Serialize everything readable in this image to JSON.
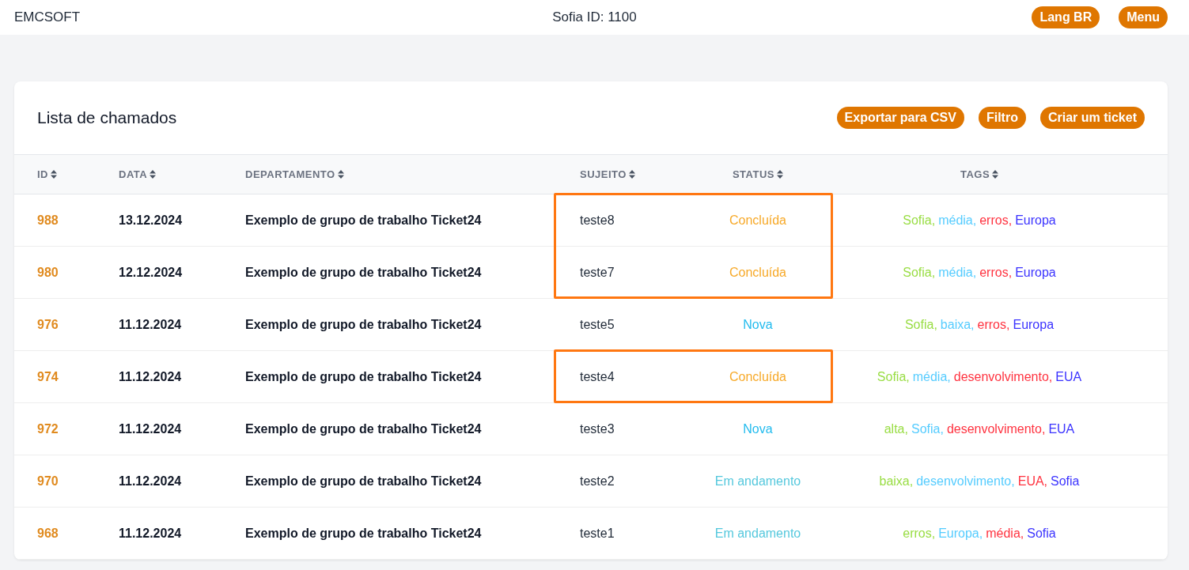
{
  "topbar": {
    "brand": "EMCSOFT",
    "user_id": "Sofia ID: 1100",
    "buttons": [
      "Lang BR",
      "Menu"
    ]
  },
  "card": {
    "title": "Lista de chamados",
    "actions": [
      "Exportar para CSV",
      "Filtro",
      "Criar um ticket"
    ]
  },
  "table": {
    "columns": [
      "ID",
      "DATA",
      "DEPARTAMENTO",
      "SUJEITO",
      "STATUS",
      "TAGS"
    ],
    "rows": [
      {
        "id": "988",
        "date": "13.12.2024",
        "department": "Exemplo de grupo de trabalho Ticket24",
        "subject": "teste8",
        "status": {
          "label": "Concluída",
          "color": "#f7a928"
        },
        "highlighted": true,
        "tags": [
          {
            "label": "Sofia,",
            "color": "#99dd44"
          },
          {
            "label": "média,",
            "color": "#55ccff"
          },
          {
            "label": "erros,",
            "color": "#ff3340"
          },
          {
            "label": "Europa",
            "color": "#3b33ff"
          }
        ]
      },
      {
        "id": "980",
        "date": "12.12.2024",
        "department": "Exemplo de grupo de trabalho Ticket24",
        "subject": "teste7",
        "status": {
          "label": "Concluída",
          "color": "#f7a928"
        },
        "highlighted": true,
        "tags": [
          {
            "label": "Sofia,",
            "color": "#99dd44"
          },
          {
            "label": "média,",
            "color": "#55ccff"
          },
          {
            "label": "erros,",
            "color": "#ff3340"
          },
          {
            "label": "Europa",
            "color": "#3b33ff"
          }
        ]
      },
      {
        "id": "976",
        "date": "11.12.2024",
        "department": "Exemplo de grupo de trabalho Ticket24",
        "subject": "teste5",
        "status": {
          "label": "Nova",
          "color": "#22bbee"
        },
        "highlighted": false,
        "tags": [
          {
            "label": "Sofia,",
            "color": "#99dd44"
          },
          {
            "label": "baixa,",
            "color": "#55ccff"
          },
          {
            "label": "erros,",
            "color": "#ff3340"
          },
          {
            "label": "Europa",
            "color": "#3b33ff"
          }
        ]
      },
      {
        "id": "974",
        "date": "11.12.2024",
        "department": "Exemplo de grupo de trabalho Ticket24",
        "subject": "teste4",
        "status": {
          "label": "Concluída",
          "color": "#f7a928"
        },
        "highlighted": true,
        "tags": [
          {
            "label": "Sofia,",
            "color": "#99dd44"
          },
          {
            "label": "média,",
            "color": "#55ccff"
          },
          {
            "label": "desenvolvimento,",
            "color": "#ff3340"
          },
          {
            "label": "EUA",
            "color": "#3b33ff"
          }
        ]
      },
      {
        "id": "972",
        "date": "11.12.2024",
        "department": "Exemplo de grupo de trabalho Ticket24",
        "subject": "teste3",
        "status": {
          "label": "Nova",
          "color": "#22bbee"
        },
        "highlighted": false,
        "tags": [
          {
            "label": "alta,",
            "color": "#99dd44"
          },
          {
            "label": "Sofia,",
            "color": "#55ccff"
          },
          {
            "label": "desenvolvimento,",
            "color": "#ff3340"
          },
          {
            "label": "EUA",
            "color": "#3b33ff"
          }
        ]
      },
      {
        "id": "970",
        "date": "11.12.2024",
        "department": "Exemplo de grupo de trabalho Ticket24",
        "subject": "teste2",
        "status": {
          "label": "Em andamento",
          "color": "#55c8dd"
        },
        "highlighted": false,
        "tags": [
          {
            "label": "baixa,",
            "color": "#99dd44"
          },
          {
            "label": "desenvolvimento,",
            "color": "#55ccff"
          },
          {
            "label": "EUA,",
            "color": "#ff3340"
          },
          {
            "label": "Sofia",
            "color": "#3b33ff"
          }
        ]
      },
      {
        "id": "968",
        "date": "11.12.2024",
        "department": "Exemplo de grupo de trabalho Ticket24",
        "subject": "teste1",
        "status": {
          "label": "Em andamento",
          "color": "#55c8dd"
        },
        "highlighted": false,
        "tags": [
          {
            "label": "erros,",
            "color": "#99dd44"
          },
          {
            "label": "Europa,",
            "color": "#55ccff"
          },
          {
            "label": "média,",
            "color": "#ff3340"
          },
          {
            "label": "Sofia",
            "color": "#3b33ff"
          }
        ]
      }
    ]
  }
}
